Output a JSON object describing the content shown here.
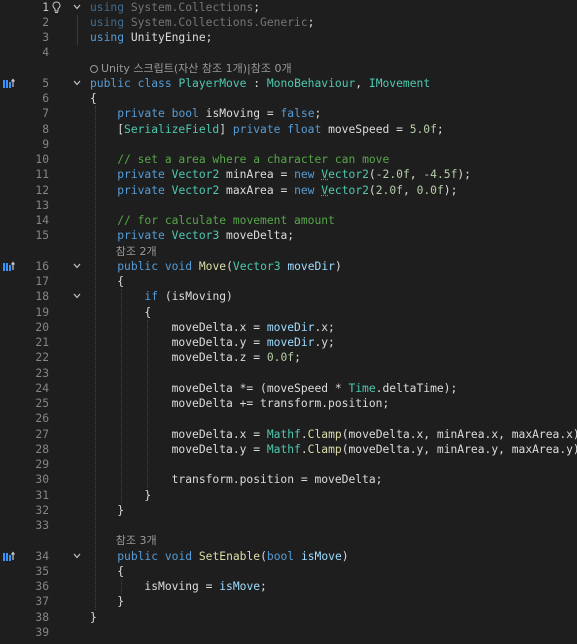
{
  "editor": {
    "lines": [
      {
        "n": "1",
        "active": true,
        "bulb": true,
        "fold": true,
        "tokens": [
          [
            "kw-dim",
            "using"
          ],
          [
            "pl",
            " "
          ],
          [
            "gr",
            "System.Collections"
          ],
          [
            "pl",
            ";"
          ]
        ]
      },
      {
        "n": "2",
        "tokens": [
          [
            "kw-dim",
            "using"
          ],
          [
            "pl",
            " "
          ],
          [
            "gr",
            "System.Collections.Generic"
          ],
          [
            "pl",
            ";"
          ]
        ]
      },
      {
        "n": "3",
        "tokens": [
          [
            "kw",
            "using"
          ],
          [
            "pl",
            " UnityEngine;"
          ]
        ]
      },
      {
        "n": "4",
        "tokens": []
      },
      {
        "codelens": true,
        "icon": true,
        "text": "Unity 스크립트(자산 참조 1개)|참조 0개"
      },
      {
        "n": "5",
        "gicon": "implements",
        "fold": true,
        "tokens": [
          [
            "kw",
            "public"
          ],
          [
            "pl",
            " "
          ],
          [
            "kw",
            "class"
          ],
          [
            "pl",
            " "
          ],
          [
            "ty",
            "PlayerMove"
          ],
          [
            "pl",
            " : "
          ],
          [
            "ty",
            "MonoBehaviour"
          ],
          [
            "pl",
            ", "
          ],
          [
            "ty",
            "IMovement"
          ]
        ]
      },
      {
        "n": "6",
        "tokens": [
          [
            "pl",
            "{"
          ]
        ]
      },
      {
        "n": "7",
        "tokens": [
          [
            "pl",
            "    "
          ],
          [
            "kw",
            "private"
          ],
          [
            "pl",
            " "
          ],
          [
            "kw",
            "bool"
          ],
          [
            "pl",
            " isMoving = "
          ],
          [
            "kw",
            "false"
          ],
          [
            "pl",
            ";"
          ]
        ]
      },
      {
        "n": "8",
        "tokens": [
          [
            "pl",
            "    ["
          ],
          [
            "ty",
            "SerializeField"
          ],
          [
            "pl",
            "] "
          ],
          [
            "kw",
            "private"
          ],
          [
            "pl",
            " "
          ],
          [
            "kw",
            "float"
          ],
          [
            "pl",
            " moveSpeed = "
          ],
          [
            "nu",
            "5.0f"
          ],
          [
            "pl",
            ";"
          ]
        ]
      },
      {
        "n": "9",
        "tokens": []
      },
      {
        "n": "10",
        "tokens": [
          [
            "pl",
            "    "
          ],
          [
            "cm",
            "// set a area where a character can move"
          ]
        ]
      },
      {
        "n": "11",
        "tokens": [
          [
            "pl",
            "    "
          ],
          [
            "kw",
            "private"
          ],
          [
            "pl",
            " "
          ],
          [
            "ty",
            "Vector2"
          ],
          [
            "pl",
            " minArea = "
          ],
          [
            "kw",
            "new"
          ],
          [
            "pl",
            " "
          ],
          [
            "tysq",
            "V"
          ],
          [
            "ty",
            "ector2"
          ],
          [
            "pl",
            "("
          ],
          [
            "nu",
            "-2.0f"
          ],
          [
            "pl",
            ", "
          ],
          [
            "nu",
            "-4.5f"
          ],
          [
            "pl",
            ");"
          ]
        ]
      },
      {
        "n": "12",
        "tokens": [
          [
            "pl",
            "    "
          ],
          [
            "kw",
            "private"
          ],
          [
            "pl",
            " "
          ],
          [
            "ty",
            "Vector2"
          ],
          [
            "pl",
            " maxArea = "
          ],
          [
            "kw",
            "new"
          ],
          [
            "pl",
            " "
          ],
          [
            "tysq",
            "V"
          ],
          [
            "ty",
            "ector2"
          ],
          [
            "pl",
            "("
          ],
          [
            "nu",
            "2.0f"
          ],
          [
            "pl",
            ", "
          ],
          [
            "nu",
            "0.0f"
          ],
          [
            "pl",
            ");"
          ]
        ]
      },
      {
        "n": "13",
        "tokens": []
      },
      {
        "n": "14",
        "tokens": [
          [
            "pl",
            "    "
          ],
          [
            "cm",
            "// for calculate movement amount"
          ]
        ]
      },
      {
        "n": "15",
        "tokens": [
          [
            "pl",
            "    "
          ],
          [
            "kw",
            "private"
          ],
          [
            "pl",
            " "
          ],
          [
            "ty",
            "Vector3"
          ],
          [
            "pl",
            " moveDelta;"
          ]
        ]
      },
      {
        "codelens": true,
        "indent": "    ",
        "text": "참조 2개"
      },
      {
        "n": "16",
        "gicon": "implements",
        "fold": true,
        "tokens": [
          [
            "pl",
            "    "
          ],
          [
            "kw",
            "public"
          ],
          [
            "pl",
            " "
          ],
          [
            "kw",
            "void"
          ],
          [
            "pl",
            " "
          ],
          [
            "fn",
            "Move"
          ],
          [
            "pl",
            "("
          ],
          [
            "ty",
            "Vector3"
          ],
          [
            "pl",
            " "
          ],
          [
            "pa",
            "moveDir"
          ],
          [
            "pl",
            ")"
          ]
        ]
      },
      {
        "n": "17",
        "tokens": [
          [
            "pl",
            "    {"
          ]
        ]
      },
      {
        "n": "18",
        "fold": true,
        "tokens": [
          [
            "pl",
            "        "
          ],
          [
            "kw",
            "if"
          ],
          [
            "pl",
            " (isMoving)"
          ]
        ]
      },
      {
        "n": "19",
        "tokens": [
          [
            "pl",
            "        {"
          ]
        ]
      },
      {
        "n": "20",
        "tokens": [
          [
            "pl",
            "            moveDelta.x = "
          ],
          [
            "pa",
            "moveDir"
          ],
          [
            "pl",
            ".x;"
          ]
        ]
      },
      {
        "n": "21",
        "tokens": [
          [
            "pl",
            "            moveDelta.y = "
          ],
          [
            "pa",
            "moveDir"
          ],
          [
            "pl",
            ".y;"
          ]
        ]
      },
      {
        "n": "22",
        "tokens": [
          [
            "pl",
            "            moveDelta.z = "
          ],
          [
            "nu",
            "0.0f"
          ],
          [
            "pl",
            ";"
          ]
        ]
      },
      {
        "n": "23",
        "tokens": []
      },
      {
        "n": "24",
        "tokens": [
          [
            "pl",
            "            moveDelta *= (moveSpeed * "
          ],
          [
            "ty",
            "Time"
          ],
          [
            "pl",
            ".deltaTime);"
          ]
        ]
      },
      {
        "n": "25",
        "tokens": [
          [
            "pl",
            "            moveDelta += transform.position;"
          ]
        ]
      },
      {
        "n": "26",
        "tokens": []
      },
      {
        "n": "27",
        "tokens": [
          [
            "pl",
            "            moveDelta.x = "
          ],
          [
            "ty",
            "Mathf"
          ],
          [
            "pl",
            "."
          ],
          [
            "fn",
            "Clamp"
          ],
          [
            "pl",
            "(moveDelta.x, minArea.x, maxArea.x);"
          ]
        ]
      },
      {
        "n": "28",
        "tokens": [
          [
            "pl",
            "            moveDelta.y = "
          ],
          [
            "ty",
            "Mathf"
          ],
          [
            "pl",
            "."
          ],
          [
            "fn",
            "Clamp"
          ],
          [
            "pl",
            "(moveDelta.y, minArea.y, maxArea.y);"
          ]
        ]
      },
      {
        "n": "29",
        "tokens": []
      },
      {
        "n": "30",
        "tokens": [
          [
            "pl",
            "            transform.position = moveDelta;"
          ]
        ]
      },
      {
        "n": "31",
        "tokens": [
          [
            "pl",
            "        }"
          ]
        ]
      },
      {
        "n": "32",
        "tokens": [
          [
            "pl",
            "    }"
          ]
        ]
      },
      {
        "n": "33",
        "tokens": []
      },
      {
        "codelens": true,
        "indent": "    ",
        "text": "참조 3개"
      },
      {
        "n": "34",
        "gicon": "implements",
        "fold": true,
        "tokens": [
          [
            "pl",
            "    "
          ],
          [
            "kw",
            "public"
          ],
          [
            "pl",
            " "
          ],
          [
            "kw",
            "void"
          ],
          [
            "pl",
            " "
          ],
          [
            "fn",
            "SetEnable"
          ],
          [
            "pl",
            "("
          ],
          [
            "kw",
            "bool"
          ],
          [
            "pl",
            " "
          ],
          [
            "pa",
            "isMove"
          ],
          [
            "pl",
            ")"
          ]
        ]
      },
      {
        "n": "35",
        "tokens": [
          [
            "pl",
            "    {"
          ]
        ]
      },
      {
        "n": "36",
        "tokens": [
          [
            "pl",
            "        isMoving = "
          ],
          [
            "pa",
            "isMove"
          ],
          [
            "pl",
            ";"
          ]
        ]
      },
      {
        "n": "37",
        "tokens": [
          [
            "pl",
            "    }"
          ]
        ]
      },
      {
        "n": "38",
        "tokens": [
          [
            "pl",
            "}"
          ]
        ]
      },
      {
        "n": "39",
        "tokens": []
      }
    ]
  },
  "colors": {
    "background": "#1e1e1e",
    "keyword": "#569cd6",
    "type": "#4ec9b0",
    "function": "#dcdcaa",
    "parameter": "#9cdcfe",
    "number": "#b5cea8",
    "comment": "#57a64a",
    "plain": "#dcdcdc"
  },
  "icons": {
    "lightbulb": "lightbulb-icon",
    "fold": "chevron-down-icon",
    "implements": "implements-interface-icon",
    "codelens": "unity-codelens-icon"
  }
}
